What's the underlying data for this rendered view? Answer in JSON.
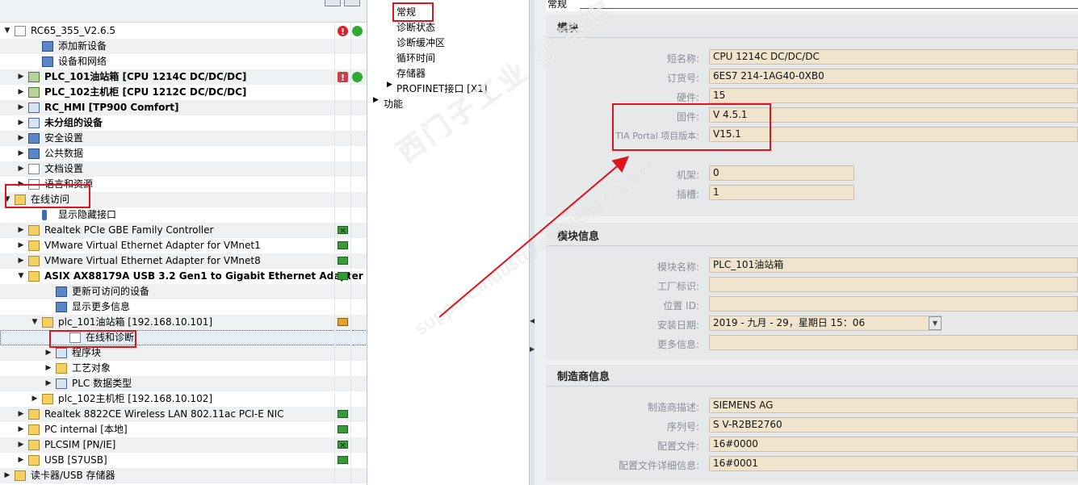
{
  "tree": {
    "rows": [
      {
        "label": "RC65_355_V2.6.5",
        "indent": 0,
        "arrow": "down",
        "icon": "document-icon",
        "bold": false,
        "status": "error-online"
      },
      {
        "label": "添加新设备",
        "indent": 2,
        "arrow": "",
        "icon": "add-device-icon",
        "bold": false,
        "status": ""
      },
      {
        "label": "设备和网络",
        "indent": 2,
        "arrow": "",
        "icon": "network-icon",
        "bold": false,
        "status": ""
      },
      {
        "label": "PLC_101油站箱 [CPU 1214C DC/DC/DC]",
        "indent": 1,
        "arrow": "right",
        "icon": "plc-icon",
        "bold": true,
        "status": "fault-online"
      },
      {
        "label": "PLC_102主机柜 [CPU 1212C DC/DC/DC]",
        "indent": 1,
        "arrow": "right",
        "icon": "plc-icon",
        "bold": true,
        "status": ""
      },
      {
        "label": "RC_HMI [TP900 Comfort]",
        "indent": 1,
        "arrow": "right",
        "icon": "hmi-icon",
        "bold": true,
        "status": ""
      },
      {
        "label": "未分组的设备",
        "indent": 1,
        "arrow": "right",
        "icon": "ungrouped-devices-icon",
        "bold": true,
        "status": ""
      },
      {
        "label": "安全设置",
        "indent": 1,
        "arrow": "right",
        "icon": "security-icon",
        "bold": false,
        "status": ""
      },
      {
        "label": "公共数据",
        "indent": 1,
        "arrow": "right",
        "icon": "common-data-icon",
        "bold": false,
        "status": ""
      },
      {
        "label": "文档设置",
        "indent": 1,
        "arrow": "right",
        "icon": "doc-settings-icon",
        "bold": false,
        "status": ""
      },
      {
        "label": "语言和资源",
        "indent": 1,
        "arrow": "right",
        "icon": "language-icon",
        "bold": false,
        "status": ""
      },
      {
        "label": "在线访问",
        "indent": 0,
        "arrow": "down",
        "icon": "online-access-icon",
        "bold": false,
        "status": ""
      },
      {
        "label": "显示隐藏接口",
        "indent": 2,
        "arrow": "",
        "icon": "interface-icon",
        "bold": false,
        "status": ""
      },
      {
        "label": "Realtek PCIe GBE Family Controller",
        "indent": 1,
        "arrow": "right",
        "icon": "adapter-icon",
        "bold": false,
        "status": "net-x"
      },
      {
        "label": "VMware Virtual Ethernet Adapter for VMnet1",
        "indent": 1,
        "arrow": "right",
        "icon": "adapter-icon",
        "bold": false,
        "status": "net"
      },
      {
        "label": "VMware Virtual Ethernet Adapter for VMnet8",
        "indent": 1,
        "arrow": "right",
        "icon": "adapter-icon",
        "bold": false,
        "status": "net"
      },
      {
        "label": "ASIX AX88179A USB 3.2 Gen1 to Gigabit Ethernet Adapter",
        "indent": 1,
        "arrow": "down",
        "icon": "adapter-icon",
        "bold": true,
        "status": "net-ok"
      },
      {
        "label": "更新可访问的设备",
        "indent": 3,
        "arrow": "",
        "icon": "update-devices-icon",
        "bold": false,
        "status": ""
      },
      {
        "label": "显示更多信息",
        "indent": 3,
        "arrow": "",
        "icon": "more-info-icon",
        "bold": false,
        "status": ""
      },
      {
        "label": "plc_101油站箱 [192.168.10.101]",
        "indent": 2,
        "arrow": "down",
        "icon": "plc-folder-icon",
        "bold": false,
        "status": "online-plc"
      },
      {
        "label": "在线和诊断",
        "indent": 4,
        "arrow": "",
        "icon": "diagnostics-icon",
        "bold": false,
        "status": "",
        "selected": true
      },
      {
        "label": "程序块",
        "indent": 3,
        "arrow": "right",
        "icon": "program-blocks-icon",
        "bold": false,
        "status": ""
      },
      {
        "label": "工艺对象",
        "indent": 3,
        "arrow": "right",
        "icon": "technology-objects-icon",
        "bold": false,
        "status": ""
      },
      {
        "label": "PLC 数据类型",
        "indent": 3,
        "arrow": "right",
        "icon": "plc-data-types-icon",
        "bold": false,
        "status": ""
      },
      {
        "label": "plc_102主机柜 [192.168.10.102]",
        "indent": 2,
        "arrow": "right",
        "icon": "plc-folder-icon",
        "bold": false,
        "status": ""
      },
      {
        "label": "Realtek 8822CE Wireless LAN 802.11ac PCI-E NIC",
        "indent": 1,
        "arrow": "right",
        "icon": "adapter-icon",
        "bold": false,
        "status": "net"
      },
      {
        "label": "PC internal [本地]",
        "indent": 1,
        "arrow": "right",
        "icon": "adapter-icon",
        "bold": false,
        "status": "net"
      },
      {
        "label": "PLCSIM [PN/IE]",
        "indent": 1,
        "arrow": "right",
        "icon": "adapter-icon",
        "bold": false,
        "status": "net-x"
      },
      {
        "label": "USB [S7USB]",
        "indent": 1,
        "arrow": "right",
        "icon": "adapter-icon",
        "bold": false,
        "status": "net"
      },
      {
        "label": "读卡器/USB 存储器",
        "indent": 0,
        "arrow": "right",
        "icon": "card-reader-icon",
        "bold": false,
        "status": ""
      }
    ]
  },
  "nav": {
    "general": "常规",
    "diag_status": "诊断状态",
    "diag_buffer": "诊断缓冲区",
    "cycle_time": "循环时间",
    "memory": "存储器",
    "profinet": "PROFINET接口 [X1]",
    "functions": "功能"
  },
  "header": {
    "tab": "常规"
  },
  "module": {
    "title": "模块",
    "short_name_label": "短名称:",
    "short_name": "CPU 1214C DC/DC/DC",
    "order_no_label": "订货号:",
    "order_no": "6ES7 214-1AG40-0XB0",
    "hardware_label": "硬件:",
    "hardware": "15",
    "firmware_label": "固件:",
    "firmware": "V 4.5.1",
    "tia_label": "TIA Portal 项目版本:",
    "tia": "V15.1",
    "rack_label": "机架:",
    "rack": "0",
    "slot_label": "插槽:",
    "slot": "1"
  },
  "module_info": {
    "title": "模块信息",
    "name_label": "模块名称:",
    "name": "PLC_101油站箱",
    "plant_label": "工厂标识:",
    "plant": "",
    "location_label": "位置 ID:",
    "location": "",
    "install_date_label": "安装日期:",
    "install_date": "2019 - 九月 - 29，星期日    15：06",
    "more_info_label": "更多信息:",
    "more_info": ""
  },
  "manufacturer": {
    "title": "制造商信息",
    "desc_label": "制造商描述:",
    "desc": "SIEMENS AG",
    "serial_label": "序列号:",
    "serial": "S V-R2BE2760",
    "profile_label": "配置文件:",
    "profile": "16#0000",
    "profile_detail_label": "配置文件详细信息:",
    "profile_detail": "16#0001"
  },
  "watermark": {
    "line1": "西门子工业 找答案",
    "line2": "support.industry.siemens.com/cs"
  },
  "colors": {
    "highlight_red": "#e0121a",
    "field_bg": "#f1e4cd",
    "status_green": "#2eaa34",
    "status_red": "#d8202a"
  }
}
